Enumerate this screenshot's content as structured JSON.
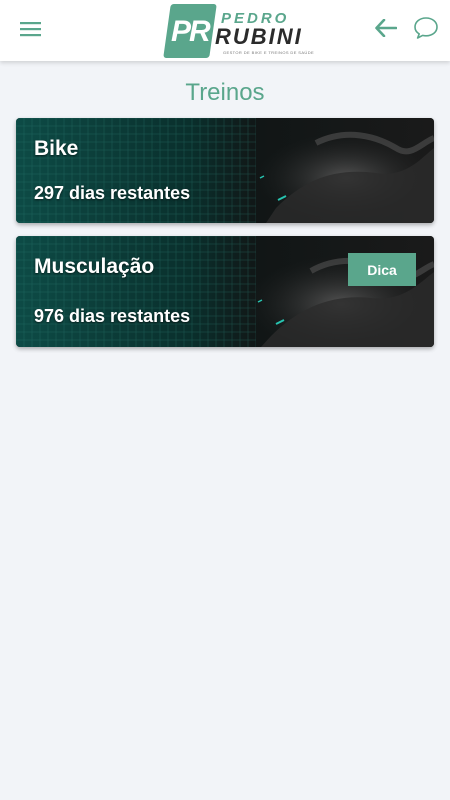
{
  "header": {
    "menu_icon": "hamburger-menu-icon",
    "logo": {
      "initials": "PR",
      "line1": "PEDRO",
      "line2": "RUBINI",
      "tagline": "GESTOR DE BIKE E TREINOS DE SAÚDE"
    },
    "back_icon": "arrow-left-icon",
    "chat_icon": "chat-bubble-icon"
  },
  "page": {
    "title": "Treinos"
  },
  "workouts": [
    {
      "name": "Bike",
      "remaining": "297 dias restantes"
    },
    {
      "name": "Musculação",
      "remaining": "976 dias restantes",
      "tip_label": "Dica"
    }
  ],
  "colors": {
    "accent": "#5aa68c",
    "background": "#f2f4f8",
    "card_dark": "#0a1212",
    "card_teal": "#0c4a45"
  }
}
